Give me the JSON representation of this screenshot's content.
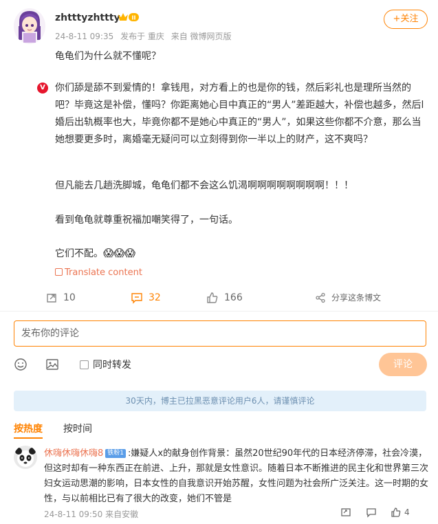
{
  "post": {
    "username": "zhtttyzhttty",
    "vip_level": "II",
    "timestamp": "24-8-11 09:35",
    "published_in_label": "发布于 重庆",
    "source": "来自 微博网页版",
    "follow_label": "+关注",
    "title_line": "龟龟们为什么就不懂呢？",
    "retweet_icon_text": "V",
    "paragraph1": "你们舔是舔不到爱情的！拿钱甩，对方看上的也是你的钱，然后彩礼也是理所当然的吧？毕竟这是补偿，懂吗？你距离她心目中真正的“男人”差距越大，补偿也越多，然后l婚后出轨概率也大，毕竟你都不是她心中真正的“男人”，如果这些你都不介意，那么当她想要更多时，离婚毫无疑问可以立刻得到你一半以上的财产，这不爽吗？",
    "paragraph2": "但凡能去几趟洗脚城，龟龟们都不会这么饥渴啊啊啊啊啊啊啊啊！！！",
    "paragraph3": "看到龟龟就尊重祝福加嘲笑得了，一句话。",
    "paragraph4": "它们不配。",
    "emojis": [
      "😱",
      "😱",
      "😱"
    ],
    "translate_label": "Translate content"
  },
  "actions": {
    "repost_count": "10",
    "comment_count": "32",
    "like_count": "166",
    "share_label": "分享这条博文"
  },
  "composer": {
    "placeholder": "发布你的评论",
    "repost_checkbox_label": "同时转发",
    "submit_label": "评论"
  },
  "notice": "30天内，博主已拉黑恶意评论用户6人，请谨慎评论",
  "sort": {
    "hot_label": "按热度",
    "time_label": "按时间"
  },
  "comment": {
    "author": "休嗨休嗨休嗨8",
    "badge": "铁粉1",
    "text": ":嫌疑人x的献身创作背景：虽然20世纪90年代的日本经济停滞，社会冷漠，但这时却有一种东西正在前进、上升，那就是女性意识。随着日本不断推进的民主化和世界第三次妇女运动思潮的影响，日本女性的自我意识开始苏醒，女性问题为社会所广泛关注。这一时期的女性，与以前相比已有了很大的改变，她们不管是",
    "timestamp": "24-8-11 09:50",
    "source": "来自安徽",
    "like_count": "4"
  },
  "colors": {
    "accent": "#ff8200",
    "link": "#eb7350",
    "notice_bg": "#e3f0fa"
  }
}
